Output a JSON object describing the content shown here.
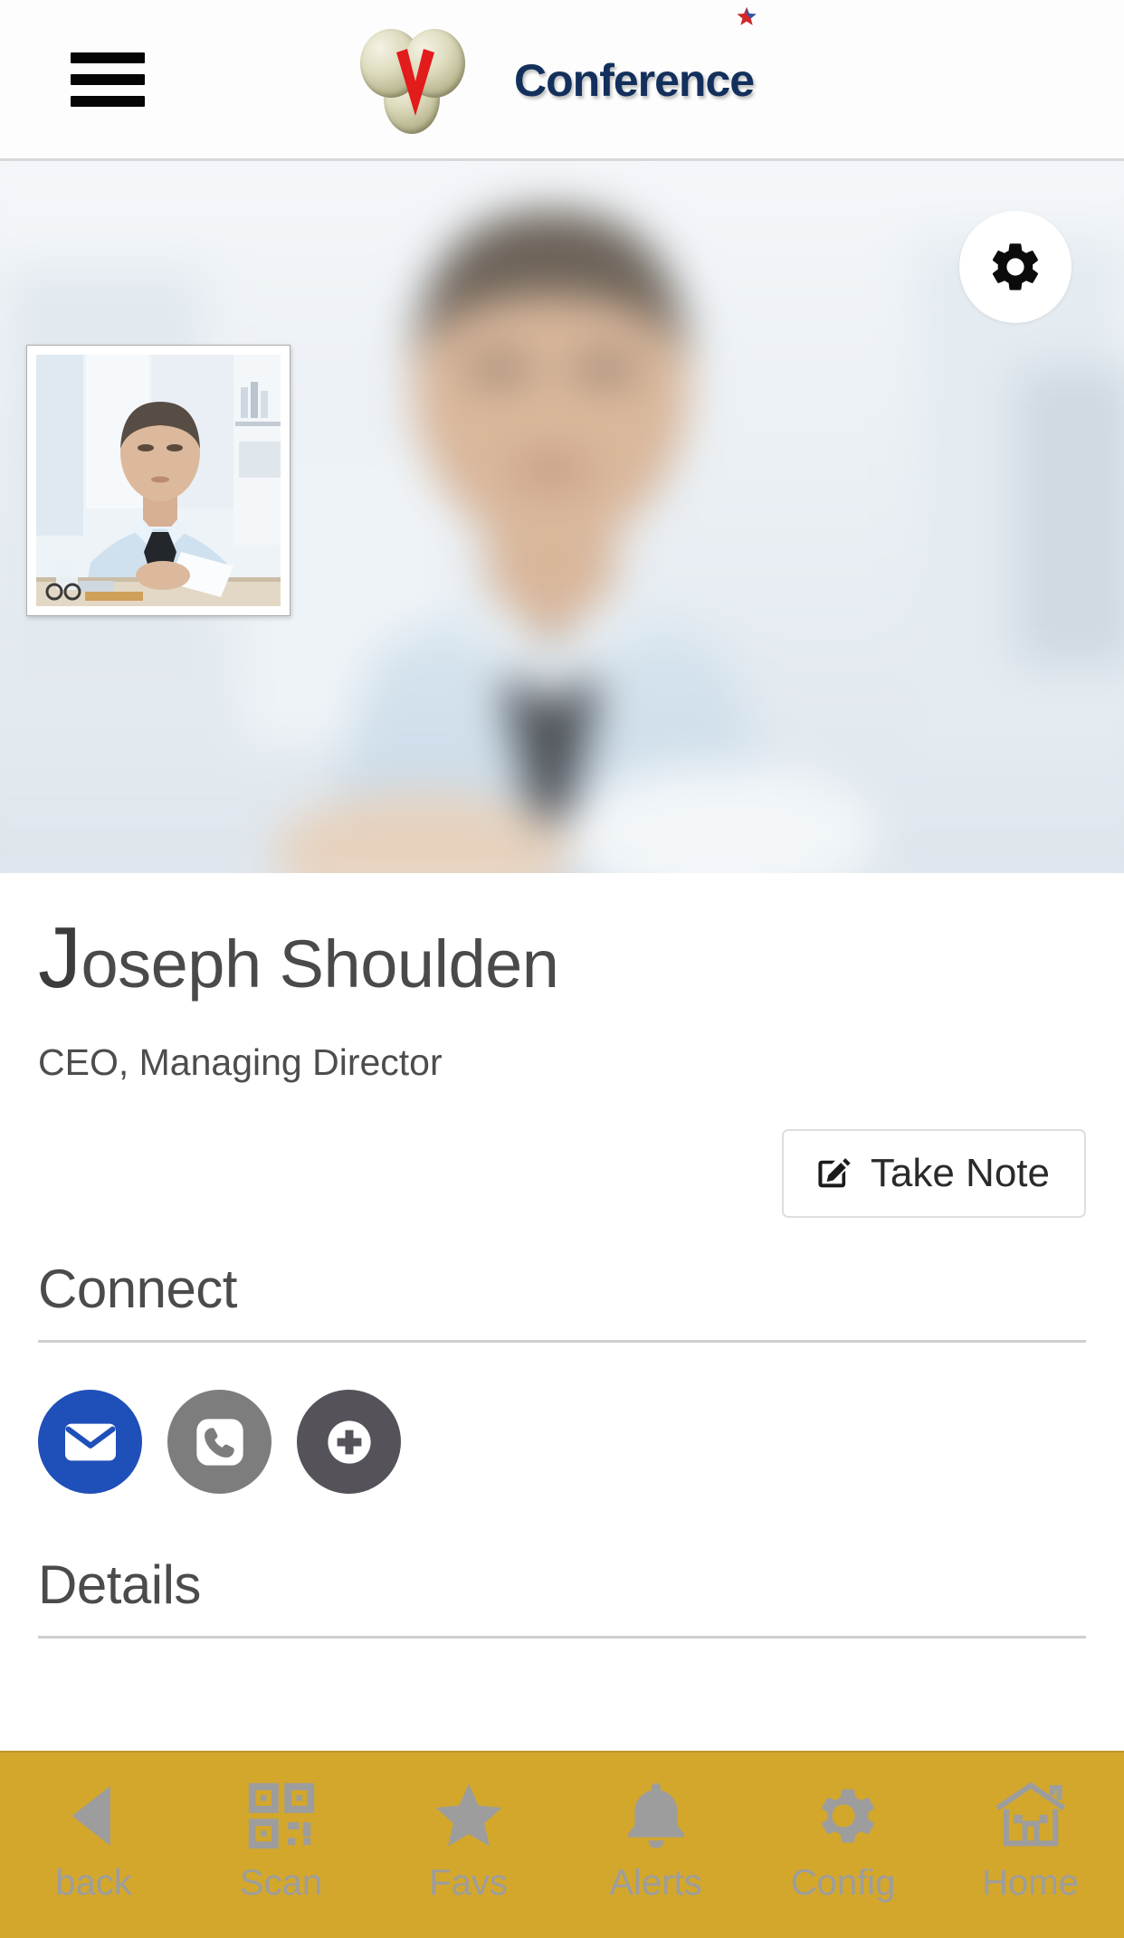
{
  "header": {
    "menu_icon": "hamburger-menu-icon",
    "logo_icon": "v-spheres-logo-icon",
    "brand_name": "Conference",
    "brand_star_icon": "star-icon",
    "brand_color": "#13305c"
  },
  "hero": {
    "banner_alt": "blurred businessman at desk",
    "settings_icon": "gear-icon",
    "thumbnail_alt": "businessman at desk portrait"
  },
  "profile": {
    "name_initial": "J",
    "name_rest": "oseph Shoulden",
    "full_name": "Joseph Shoulden",
    "title": "CEO, Managing Director"
  },
  "actions": {
    "take_note_label": "Take Note",
    "take_note_icon": "edit-note-icon"
  },
  "sections": {
    "connect_heading": "Connect",
    "details_heading": "Details"
  },
  "connect": {
    "items": [
      {
        "name": "email",
        "icon": "envelope-icon",
        "color": "#1f4fb8"
      },
      {
        "name": "phone",
        "icon": "phone-icon",
        "color": "#7d7d7d"
      },
      {
        "name": "add",
        "icon": "plus-circle-icon",
        "color": "#55525a"
      }
    ]
  },
  "tabbar": {
    "background": "#d3a72c",
    "icon_color": "#9d9d9d",
    "items": [
      {
        "label": "back",
        "icon": "back-arrow-icon"
      },
      {
        "label": "Scan",
        "icon": "qr-code-icon"
      },
      {
        "label": "Favs",
        "icon": "star-icon"
      },
      {
        "label": "Alerts",
        "icon": "bell-icon"
      },
      {
        "label": "Config",
        "icon": "gear-icon"
      },
      {
        "label": "Home",
        "icon": "home-icon"
      }
    ]
  }
}
